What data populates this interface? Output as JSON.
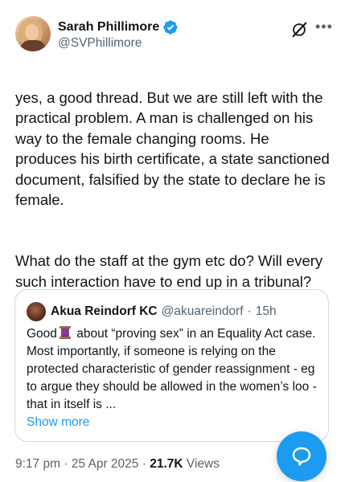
{
  "author": {
    "name": "Sarah Phillimore",
    "handle": "@SVPhillimore",
    "verified": true
  },
  "tweet": {
    "paragraphs": [
      "yes, a good thread. But we are still left with the practical problem. A man is challenged on his way to the female changing rooms. He produces his birth certificate, a state sanctioned document, falsified by the state to declare he is female.",
      "What do the staff at the gym etc do? Will every such interaction have to end up in a tribunal?"
    ]
  },
  "quote": {
    "name": "Akua Reindorf KC",
    "handle": "@akuareindorf",
    "separator": "·",
    "time": "15h",
    "text_before_emoji": "Good",
    "emoji": "thread-spool-emoji",
    "text_after_emoji": " about “proving sex” in an Equality Act case. Most importantly, if someone is relying on the protected characteristic of gender reassignment - eg to argue they should be allowed in the women’s loo - that in itself is ...",
    "show_more": "Show more"
  },
  "footer": {
    "time": "9:17 pm",
    "separator": "·",
    "date": "25 Apr 2025",
    "separator2": "·",
    "views_count": "21.7K",
    "views_label": "Views"
  },
  "colors": {
    "accent": "#1d9bf0",
    "text": "#0f1419",
    "secondary": "#536471",
    "border": "#cfd9de"
  },
  "icons": {
    "verified": "verified-badge-icon",
    "grok": "grok-icon",
    "more": "more-icon",
    "chat": "chat-bubble-icon"
  }
}
